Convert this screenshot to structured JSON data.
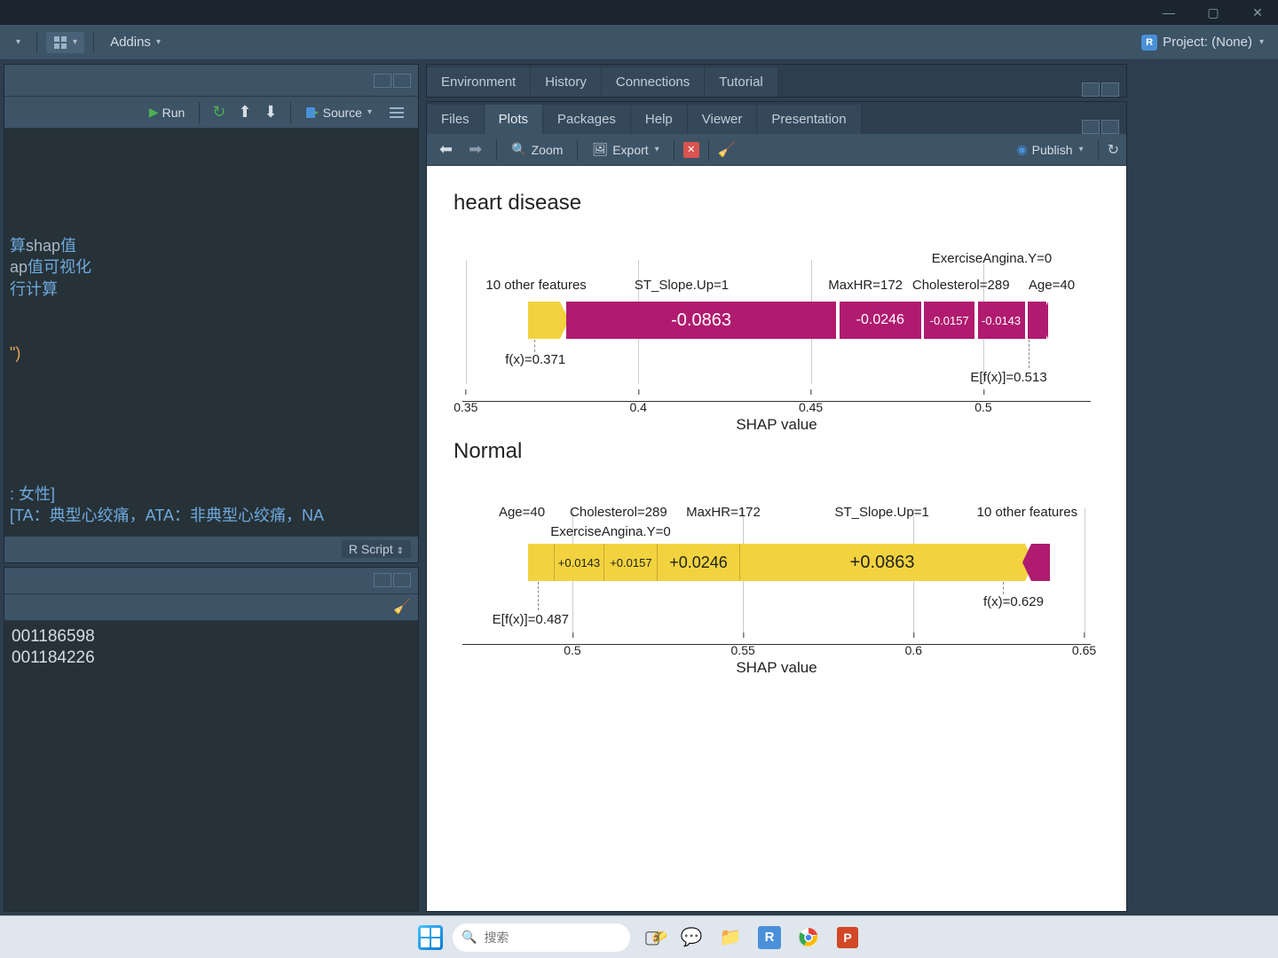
{
  "titlebar": {},
  "top_toolbar": {
    "addins_label": "Addins",
    "project_label": "Project: (None)"
  },
  "editor": {
    "run_label": "Run",
    "source_label": "Source",
    "footer_label": "R Script",
    "lines": {
      "l1a": "算",
      "l1b": "shap",
      "l1c": "值",
      "l2a": "ap",
      "l2b": "值可视化",
      "l3": "行计算",
      "l4": "\")",
      "l5": ": 女性]",
      "l6": "[TA：典型心绞痛，ATA：非典型心绞痛，NA"
    }
  },
  "console": {
    "line1": "001186598",
    "line2": "001184226"
  },
  "env_tabs": {
    "t1": "Environment",
    "t2": "History",
    "t3": "Connections",
    "t4": "Tutorial"
  },
  "plot_tabs": {
    "t1": "Files",
    "t2": "Plots",
    "t3": "Packages",
    "t4": "Help",
    "t5": "Viewer",
    "t6": "Presentation"
  },
  "plot_toolbar": {
    "zoom": "Zoom",
    "export": "Export",
    "publish": "Publish"
  },
  "chart_data": [
    {
      "type": "shap_force",
      "title": "heart disease",
      "xlabel": "SHAP value",
      "xlim": [
        0.35,
        0.51
      ],
      "ticks": [
        0.35,
        0.4,
        0.45,
        0.5
      ],
      "base_value": 0.513,
      "base_label": "E[f(x)]=0.513",
      "fx_value": 0.371,
      "fx_label": "f(x)=0.371",
      "left_tail": {
        "label": "10 other features",
        "color": "yellow"
      },
      "segments": [
        {
          "feature": "ST_Slope.Up=1",
          "value": -0.0863,
          "text": "-0.0863",
          "color": "magenta"
        },
        {
          "feature": "MaxHR=172",
          "value": -0.0246,
          "text": "-0.0246",
          "color": "magenta"
        },
        {
          "feature": "ExerciseAngina.Y=0",
          "value": -0.0157,
          "text": "-0.0157",
          "color": "magenta"
        },
        {
          "feature": "Cholesterol=289",
          "value": -0.0143,
          "text": "-0.0143",
          "color": "magenta"
        },
        {
          "feature": "Age=40",
          "value": null,
          "text": "",
          "color": "magenta"
        }
      ]
    },
    {
      "type": "shap_force",
      "title": "Normal",
      "xlabel": "SHAP value",
      "xlim": [
        0.47,
        0.65
      ],
      "ticks": [
        0.5,
        0.55,
        0.6,
        0.65
      ],
      "base_value": 0.487,
      "base_label": "E[f(x)]=0.487",
      "fx_value": 0.629,
      "fx_label": "f(x)=0.629",
      "right_tail": {
        "label": "10 other features",
        "color": "magenta"
      },
      "segments": [
        {
          "feature": "Age=40",
          "value": 0.0143,
          "text": "+0.0143",
          "color": "yellow"
        },
        {
          "feature": "ExerciseAngina.Y=0",
          "value": 0.0157,
          "text": "+0.0157",
          "color": "yellow"
        },
        {
          "feature": "Cholesterol=289",
          "value": 0.0246,
          "text": "+0.0246",
          "color": "yellow"
        },
        {
          "feature": "MaxHR=172",
          "value": 0.0863,
          "text": "+0.0863",
          "color": "yellow"
        },
        {
          "feature": "ST_Slope.Up=1",
          "value": null,
          "text": "",
          "color": "yellow"
        }
      ]
    }
  ],
  "taskbar": {
    "search_placeholder": "搜索"
  }
}
